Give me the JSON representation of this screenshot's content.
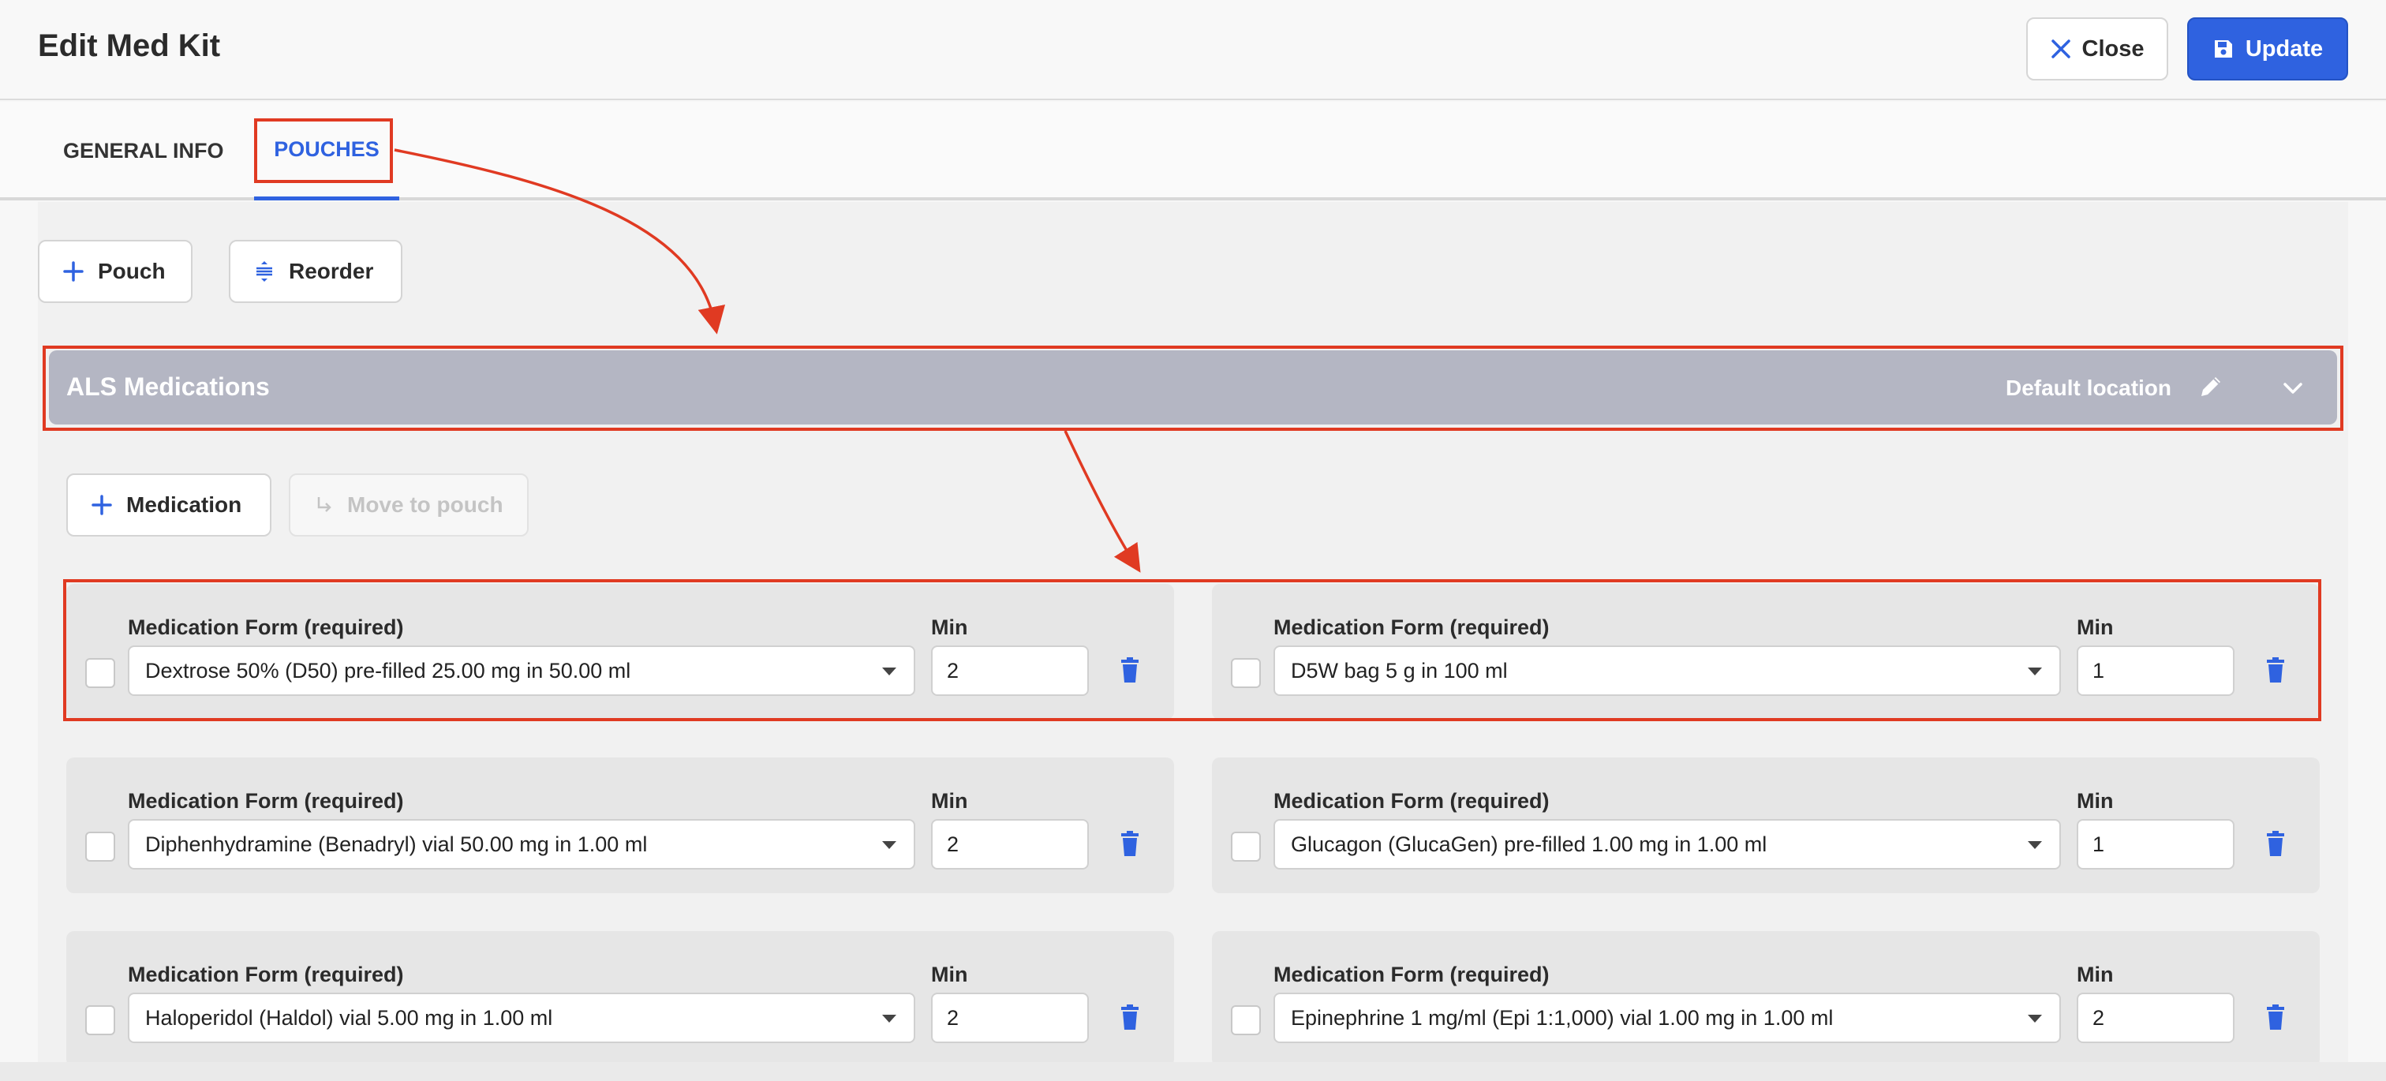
{
  "header": {
    "title": "Edit Med Kit",
    "close_label": "Close",
    "update_label": "Update"
  },
  "tabs": [
    {
      "label": "GENERAL INFO",
      "active": false
    },
    {
      "label": "POUCHES",
      "active": true
    }
  ],
  "toolbar": {
    "add_pouch_label": "Pouch",
    "reorder_label": "Reorder"
  },
  "pouch": {
    "name": "ALS Medications",
    "location": "Default location",
    "add_medication_label": "Medication",
    "move_to_pouch_label": "Move to pouch"
  },
  "labels": {
    "medication_form": "Medication Form (required)",
    "min": "Min"
  },
  "medications": [
    {
      "form": "Dextrose 50% (D50) pre-filled 25.00 mg in 50.00 ml",
      "min": "2"
    },
    {
      "form": "D5W bag 5 g in 100 ml",
      "min": "1"
    },
    {
      "form": "Diphenhydramine (Benadryl) vial 50.00 mg in 1.00 ml",
      "min": "2"
    },
    {
      "form": "Glucagon (GlucaGen) pre-filled 1.00 mg in 1.00 ml",
      "min": "1"
    },
    {
      "form": "Haloperidol (Haldol) vial 5.00 mg in 1.00 ml",
      "min": "2"
    },
    {
      "form": "Epinephrine 1 mg/ml (Epi 1:1,000) vial 1.00 mg in 1.00 ml",
      "min": "2"
    }
  ],
  "colors": {
    "accent": "#2f62e0",
    "annotation": "#e03a22",
    "pouch_bar": "#b4b6c3"
  },
  "icons": {
    "close": "close-icon",
    "update": "save-icon",
    "pouch": "plus-icon",
    "reorder": "reorder-icon",
    "edit": "pencil-icon",
    "collapse": "chevron-down-icon",
    "delete": "trash-icon",
    "move": "arrow-return-icon"
  }
}
